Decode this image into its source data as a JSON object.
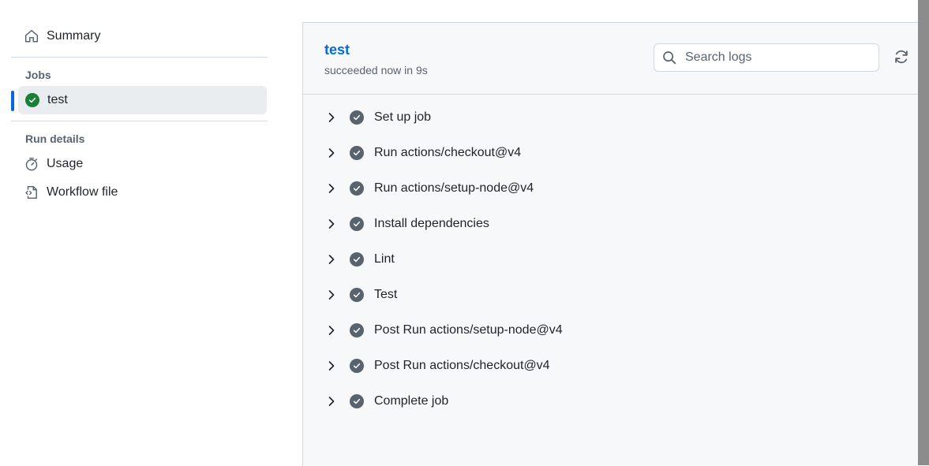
{
  "sidebar": {
    "summary_label": "Summary",
    "jobs_heading": "Jobs",
    "jobs": [
      {
        "label": "test",
        "status": "success"
      }
    ],
    "run_details_heading": "Run details",
    "usage_label": "Usage",
    "workflow_file_label": "Workflow file"
  },
  "job": {
    "title": "test",
    "subtitle": "succeeded now in 9s"
  },
  "search": {
    "placeholder": "Search logs"
  },
  "steps": [
    {
      "label": "Set up job"
    },
    {
      "label": "Run actions/checkout@v4"
    },
    {
      "label": "Run actions/setup-node@v4"
    },
    {
      "label": "Install dependencies"
    },
    {
      "label": "Lint"
    },
    {
      "label": "Test"
    },
    {
      "label": "Post Run actions/setup-node@v4"
    },
    {
      "label": "Post Run actions/checkout@v4"
    },
    {
      "label": "Complete job"
    }
  ],
  "colors": {
    "accent": "#0969da",
    "success": "#1a7f37",
    "step_check": "#59636e"
  }
}
